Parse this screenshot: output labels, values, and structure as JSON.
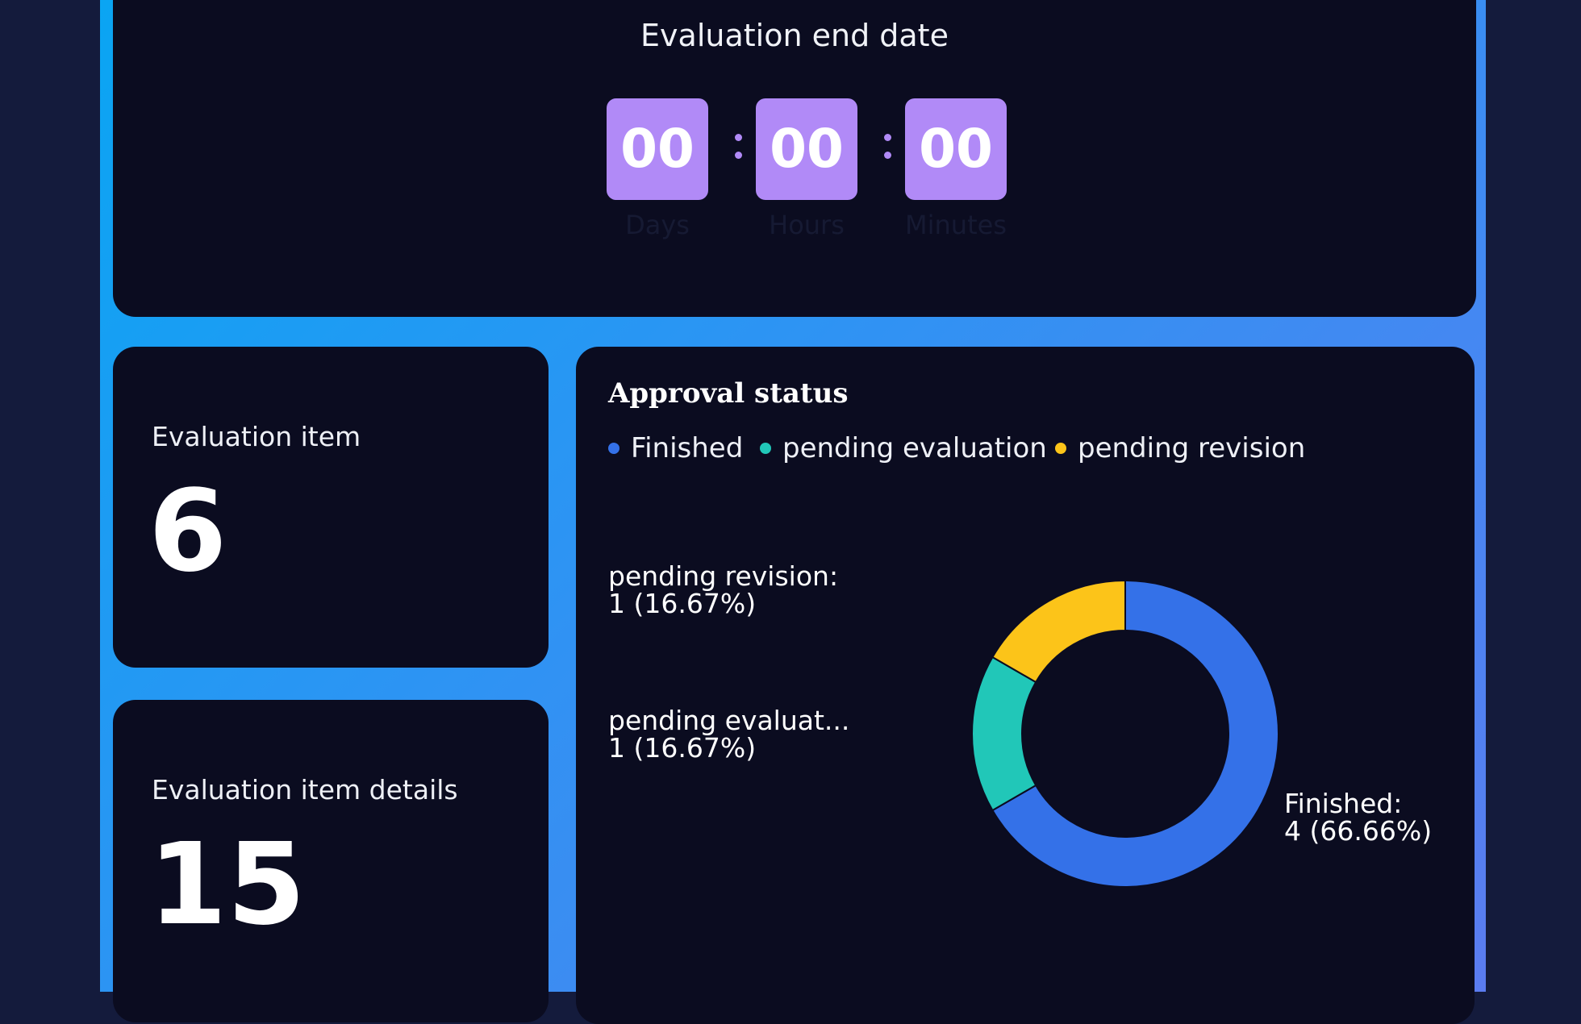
{
  "countdown": {
    "title": "Evaluation end date",
    "days": "00",
    "hours": "00",
    "minutes": "00",
    "units": [
      "Days",
      "Hours",
      "Minutes"
    ],
    "box_color": "#b18af7"
  },
  "stats": {
    "evaluation_item": {
      "label": "Evaluation item",
      "value": "6"
    },
    "evaluation_item_details": {
      "label": "Evaluation item details",
      "value": "15"
    }
  },
  "chart_data": {
    "type": "pie",
    "title": "Approval status",
    "legend_position": "top-left",
    "series": [
      {
        "name": "Finished",
        "value": 4,
        "percent": "66.66%",
        "color": "#3471e8",
        "label_name": "Finished:",
        "label_value": "4 (66.66%)"
      },
      {
        "name": "pending evaluation",
        "value": 1,
        "percent": "16.67%",
        "color": "#21c7b8",
        "label_name": "pending evaluat...",
        "label_value": "1 (16.67%)"
      },
      {
        "name": "pending revision",
        "value": 1,
        "percent": "16.67%",
        "color": "#fcc419",
        "label_name": "pending revision:",
        "label_value": "1 (16.67%)"
      }
    ]
  }
}
